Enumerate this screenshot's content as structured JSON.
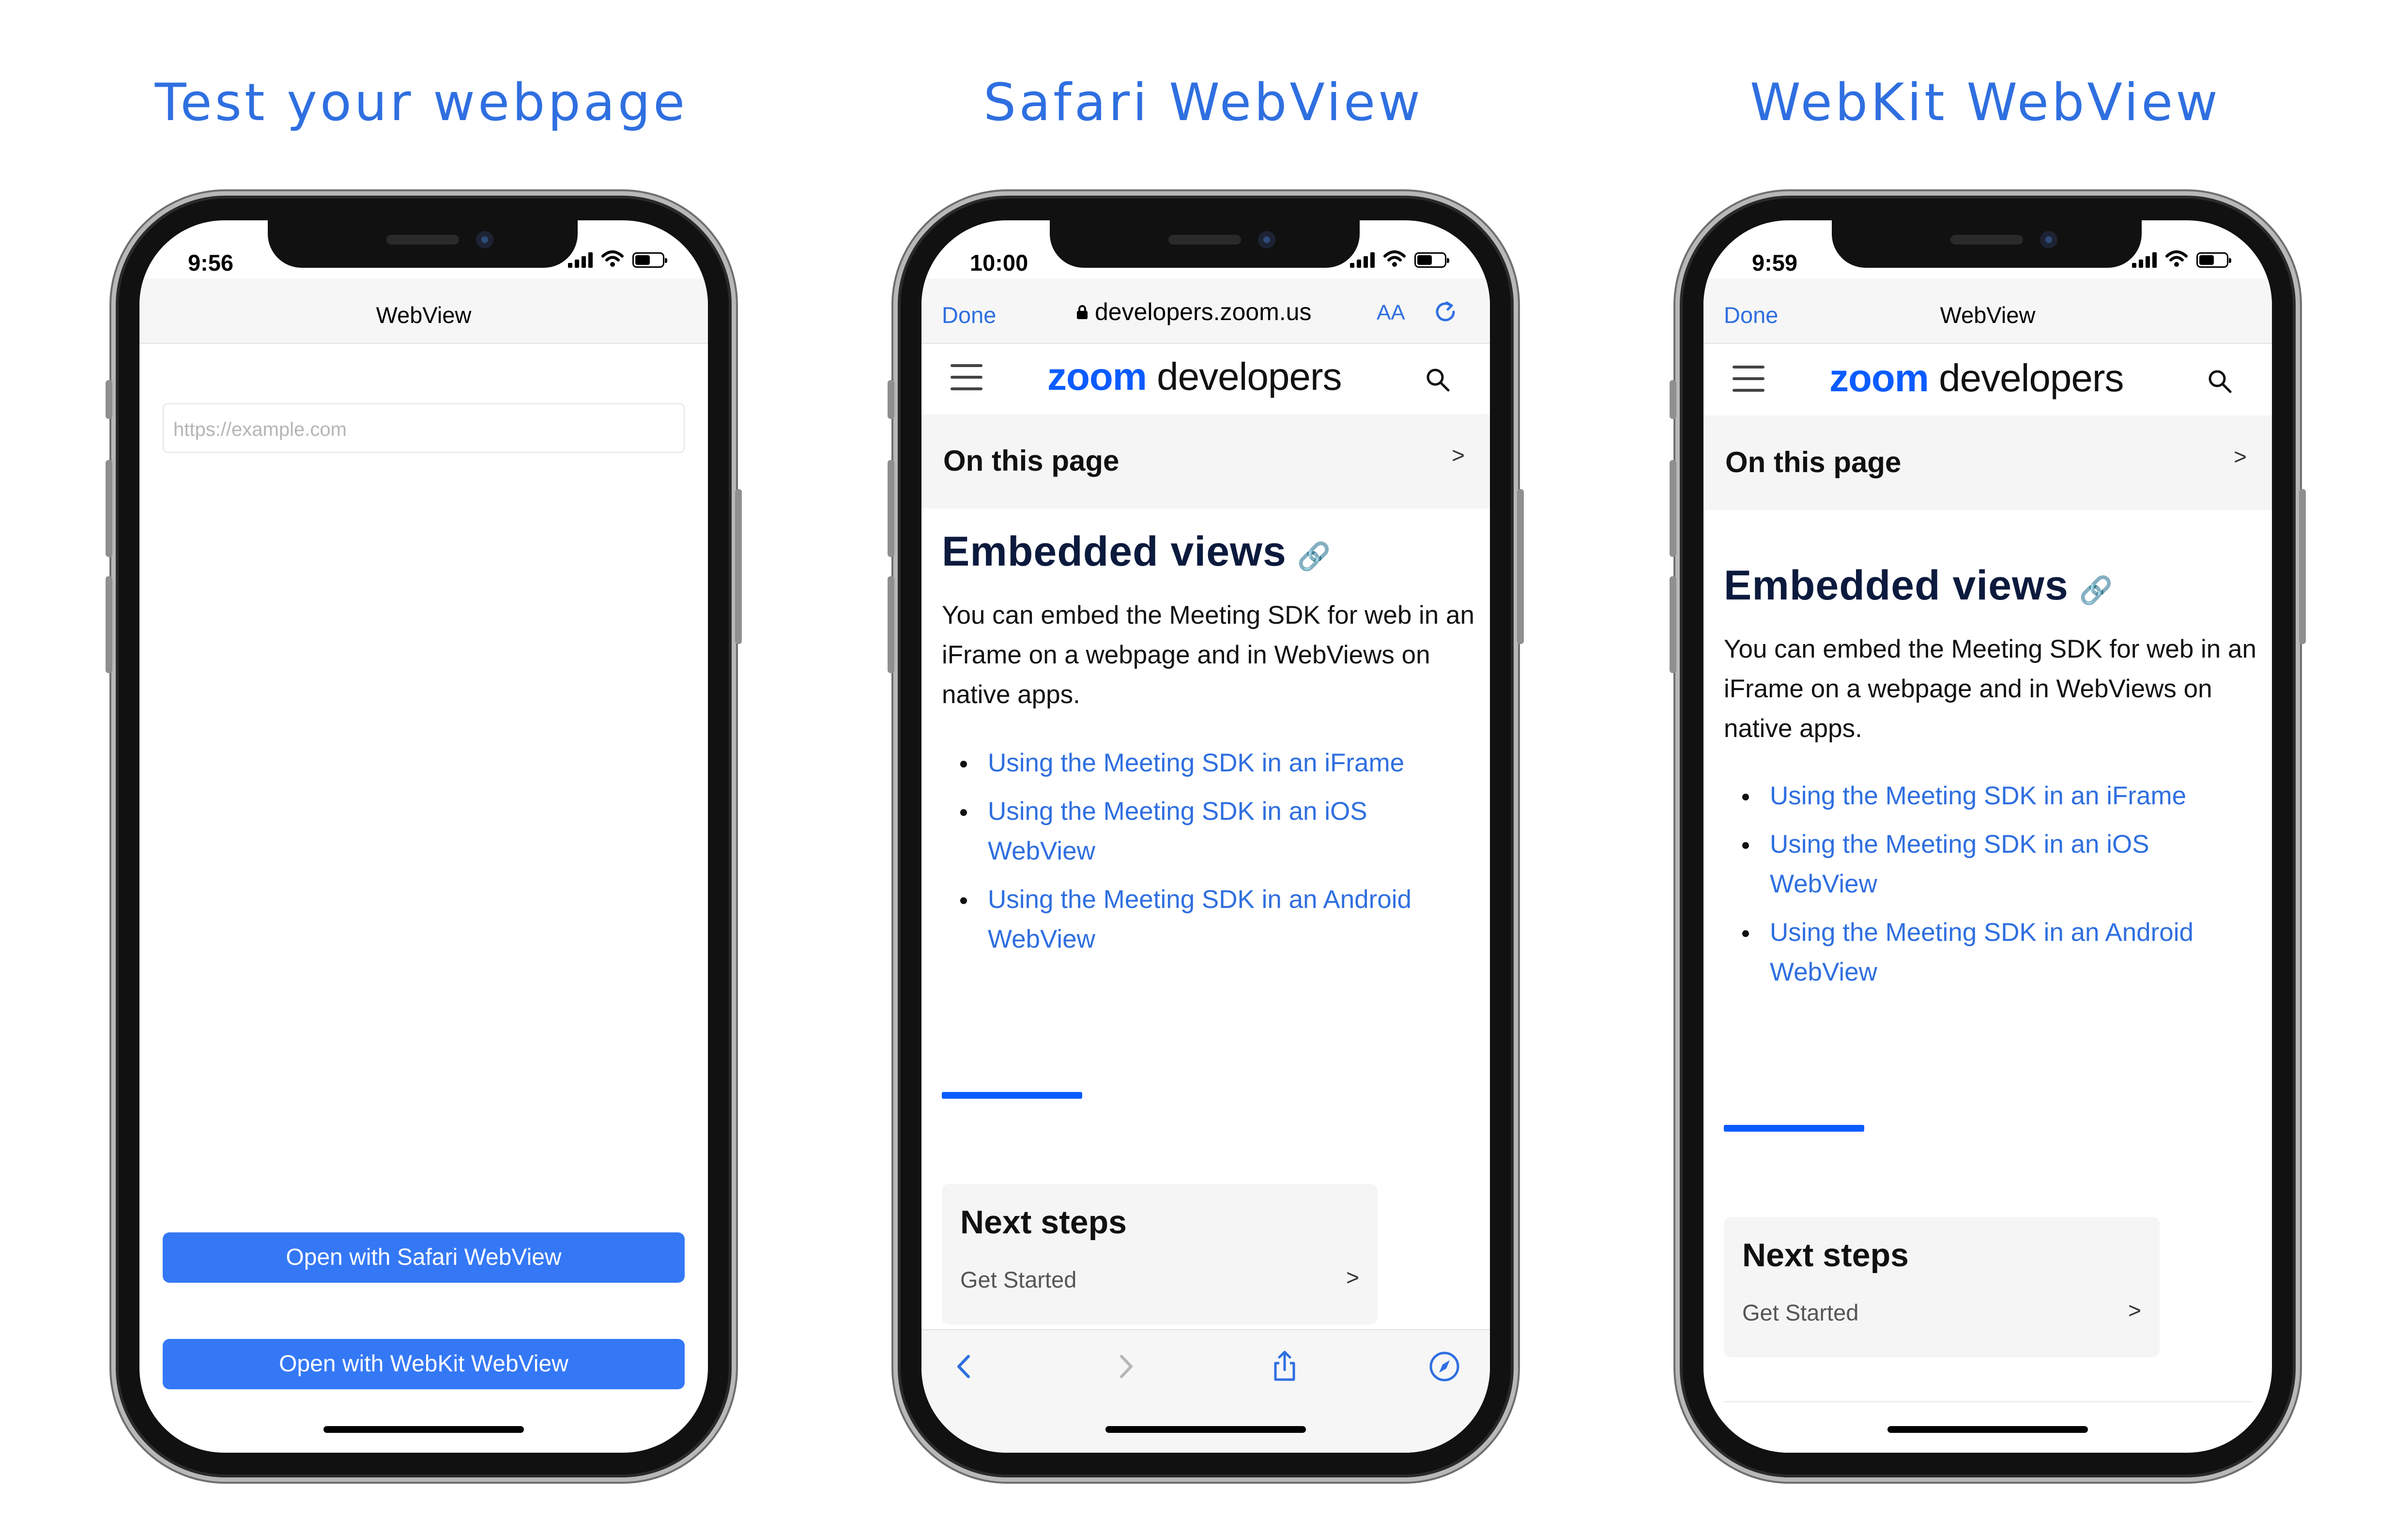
{
  "panels": [
    {
      "heading": "Test your webpage",
      "time": "9:56",
      "nav_title": "WebView",
      "url_placeholder": "https://example.com",
      "buttons": [
        "Open with Safari WebView",
        "Open with WebKit WebView"
      ]
    },
    {
      "heading": "Safari WebView",
      "time": "10:00",
      "done": "Done",
      "url": "developers.zoom.us",
      "aa": "AA"
    },
    {
      "heading": "WebKit WebView",
      "time": "9:59",
      "done": "Done",
      "nav_title": "WebView"
    }
  ],
  "site": {
    "logo_zoom": "zoom",
    "logo_developers": "developers",
    "on_this_page": "On this page",
    "chevron": ">",
    "title": "Embedded views",
    "paragraph": "You can embed the Meeting SDK for web in an iFrame on a webpage and in WebViews on native apps.",
    "links": [
      "Using the Meeting SDK in an iFrame",
      "Using the Meeting SDK in an iOS WebView",
      "Using the Meeting SDK in an Android WebView"
    ],
    "next_steps_title": "Next steps",
    "next_steps_item": "Get Started"
  },
  "colors": {
    "heading": "#2f6fe0",
    "link": "#2f6fe0",
    "button": "#3478f6",
    "zoom_blue": "#0b5cff"
  },
  "icons": [
    "signal-icon",
    "wifi-icon",
    "battery-icon",
    "lock-icon",
    "reload-icon",
    "menu-icon",
    "search-icon",
    "link-icon",
    "chevron-right-icon",
    "back-icon",
    "forward-icon",
    "share-icon",
    "compass-icon"
  ]
}
